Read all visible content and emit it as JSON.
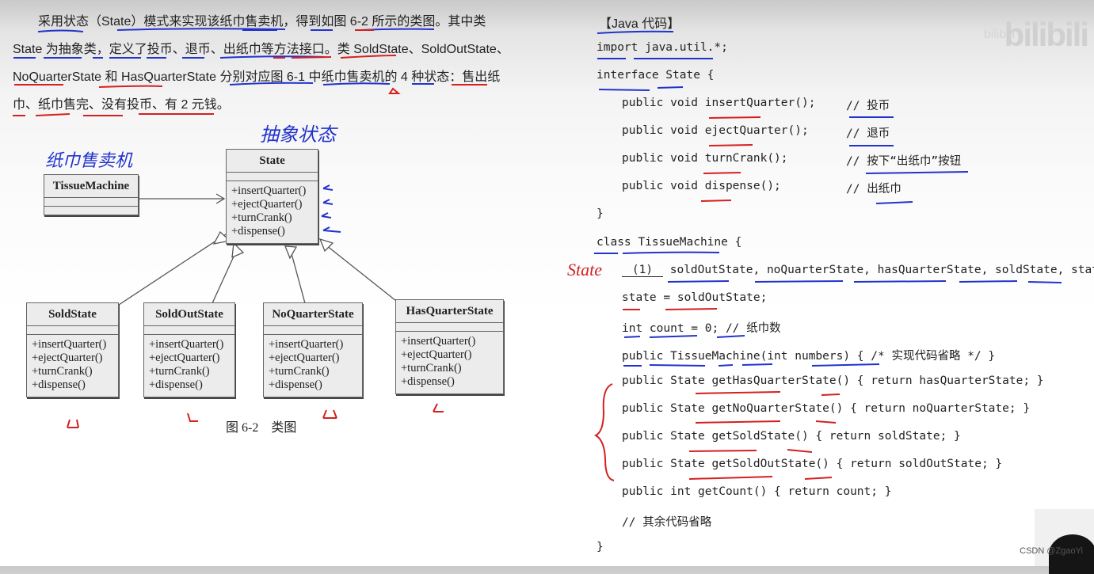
{
  "problem_text": {
    "lines": [
      "　　采用状态（State）模式来实现该纸巾售卖机，得到如图 6-2 所示的类图。其中类",
      "State 为抽象类，定义了投币、退币、出纸巾等方法接口。类 SoldState、SoldOutState、",
      "NoQuarterState 和 HasQuarterState 分别对应图 6-1 中纸巾售卖机的 4 种状态：售出纸",
      "巾、纸巾售完、没有投币、有 2 元钱。"
    ]
  },
  "diagram": {
    "handwritten_tissue_machine": "纸巾售卖机",
    "handwritten_abstract_state": "抽象状态",
    "caption": "图 6-2　类图",
    "classes": [
      {
        "name": "TissueMachine",
        "operations": []
      },
      {
        "name": "State",
        "operations": [
          "+insertQuarter()",
          "+ejectQuarter()",
          "+turnCrank()",
          "+dispense()"
        ]
      },
      {
        "name": "SoldState",
        "operations": [
          "+insertQuarter()",
          "+ejectQuarter()",
          "+turnCrank()",
          "+dispense()"
        ]
      },
      {
        "name": "SoldOutState",
        "operations": [
          "+insertQuarter()",
          "+ejectQuarter()",
          "+turnCrank()",
          "+dispense()"
        ]
      },
      {
        "name": "NoQuarterState",
        "operations": [
          "+insertQuarter()",
          "+ejectQuarter()",
          "+turnCrank()",
          "+dispense()"
        ]
      },
      {
        "name": "HasQuarterState",
        "operations": [
          "+insertQuarter()",
          "+ejectQuarter()",
          "+turnCrank()",
          "+dispense()"
        ]
      }
    ]
  },
  "code": {
    "title": "【Java 代码】",
    "lines": [
      "import java.util.*;",
      "interface State {",
      "public void insertQuarter();",
      "public void ejectQuarter();",
      "public void turnCrank();",
      "public void dispense();",
      "}",
      "class TissueMachine {",
      "soldOutState, noQuarterState, hasQuarterState, soldState, state;",
      "state = soldOutState;",
      "int count = 0; // 纸巾数",
      "public TissueMachine(int numbers) { /* 实现代码省略 */ }",
      "public State getHasQuarterState() { return hasQuarterState; }",
      "public State getNoQuarterState() { return noQuarterState; }",
      "public State getSoldState() { return soldState; }",
      "public State getSoldOutState() { return soldOutState; }",
      "public int getCount() { return count; }",
      "// 其余代码省略",
      "}"
    ],
    "comments": [
      "// 投币",
      "// 退币",
      "// 按下“出纸巾”按钮",
      "// 出纸巾"
    ],
    "blank_label": "(1)",
    "handwritten_answer": "State"
  },
  "watermark": {
    "brand": "bilibili",
    "credit": "CSDN @ZgaoYi"
  }
}
